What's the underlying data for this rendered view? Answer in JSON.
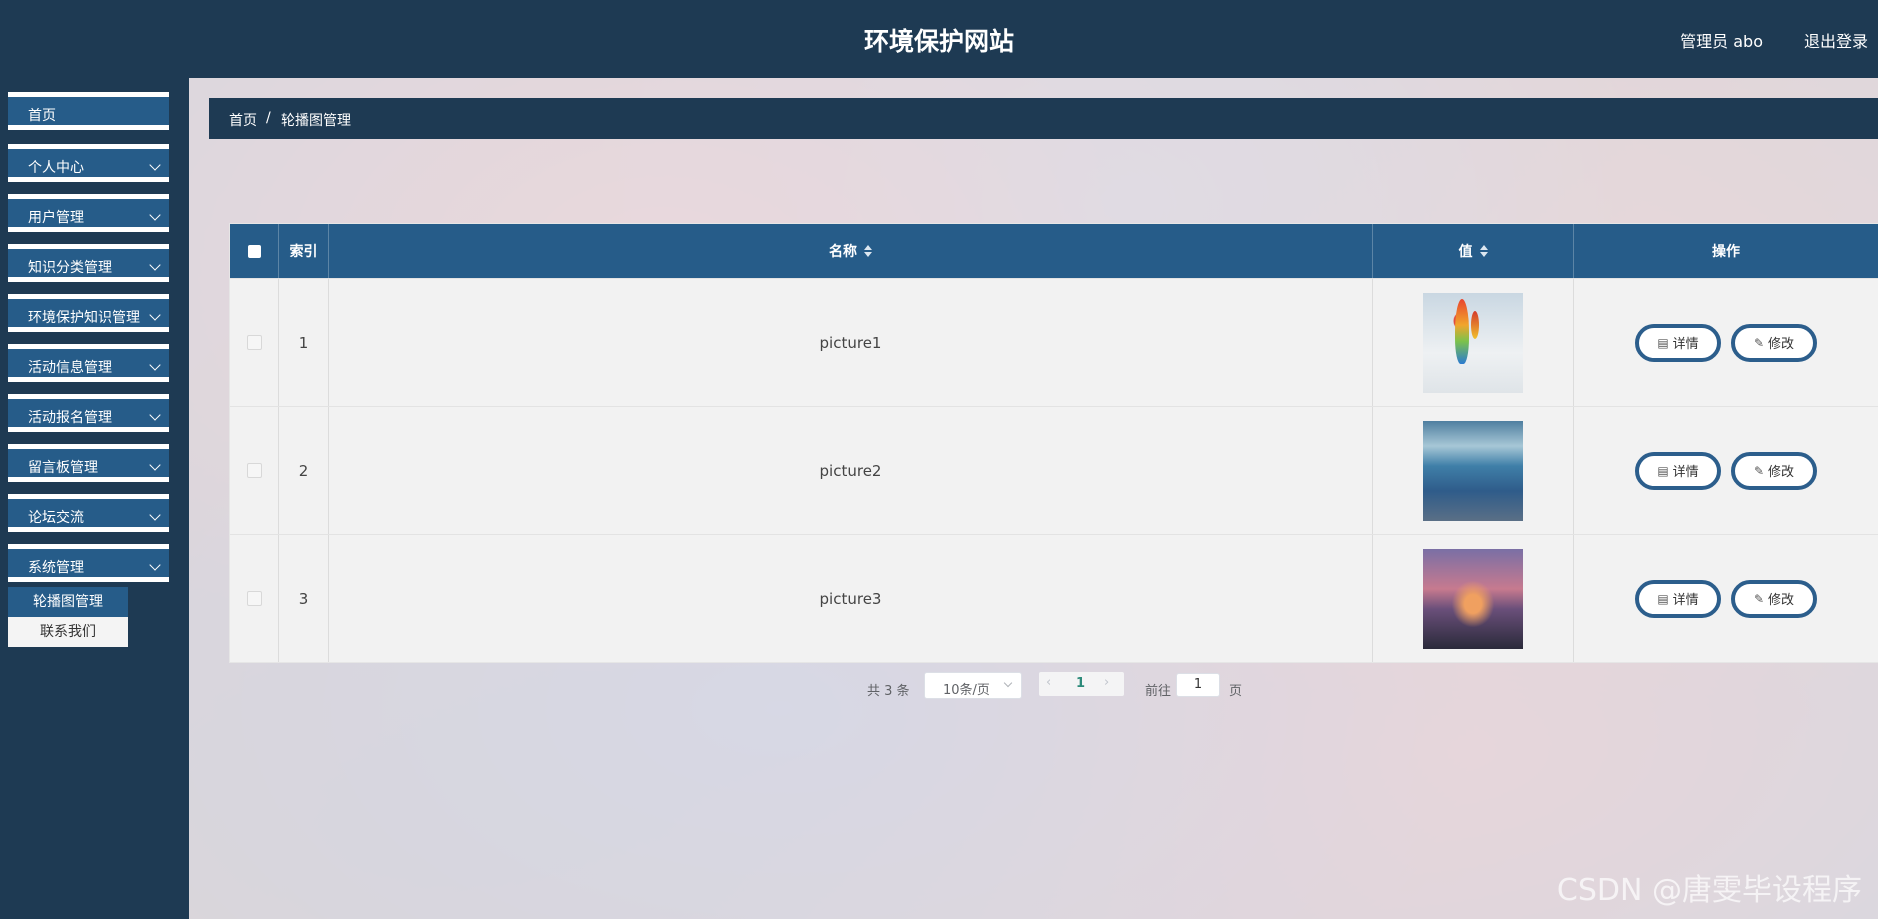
{
  "header": {
    "site_title": "环境保护网站",
    "user": "管理员 abo",
    "logout": "退出登录"
  },
  "sidebar": {
    "items": [
      {
        "label": "首页",
        "has_chevron": false
      },
      {
        "label": "个人中心",
        "has_chevron": true
      },
      {
        "label": "用户管理",
        "has_chevron": true
      },
      {
        "label": "知识分类管理",
        "has_chevron": true
      },
      {
        "label": "环境保护知识管理",
        "has_chevron": true
      },
      {
        "label": "活动信息管理",
        "has_chevron": true
      },
      {
        "label": "活动报名管理",
        "has_chevron": true
      },
      {
        "label": "留言板管理",
        "has_chevron": true
      },
      {
        "label": "论坛交流",
        "has_chevron": true
      },
      {
        "label": "系统管理",
        "has_chevron": true
      }
    ],
    "subitems": [
      {
        "label": "轮播图管理",
        "active": true
      },
      {
        "label": "联系我们",
        "active": false
      }
    ]
  },
  "breadcrumb": {
    "home": "首页",
    "separator": "/",
    "current": "轮播图管理"
  },
  "table": {
    "headers": {
      "index": "索引",
      "name": "名称",
      "value": "值",
      "actions": "操作"
    },
    "rows": [
      {
        "index": "1",
        "name": "picture1",
        "image": "hot-air-balloons"
      },
      {
        "index": "2",
        "name": "picture2",
        "image": "blue-seascape"
      },
      {
        "index": "3",
        "name": "picture3",
        "image": "city-sunset"
      }
    ],
    "detail_label": "详情",
    "edit_label": "修改"
  },
  "pagination": {
    "total": "共 3 条",
    "page_size": "10条/页",
    "current_page": "1",
    "goto_label": "前往",
    "goto_value": "1",
    "page_unit": "页"
  },
  "watermark": "CSDN @唐雯毕设程序",
  "colors": {
    "header_bg": "#1e3a53",
    "primary": "#265c89",
    "button_border": "#2c5e8c"
  }
}
